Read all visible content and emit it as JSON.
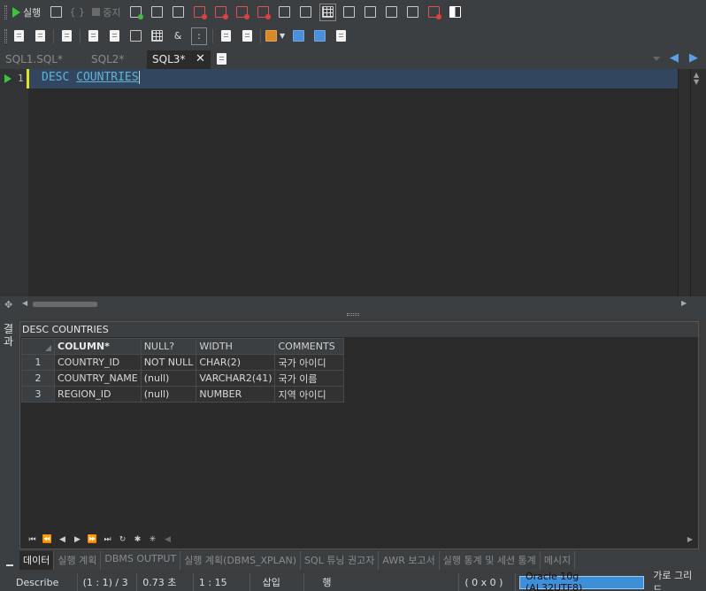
{
  "toolbar1": {
    "run_label": "실행",
    "stop_label": "중지",
    "misc_glyph": "{ }"
  },
  "toolbar2": {
    "ampersand": "&",
    "colon": ":"
  },
  "tabs": [
    {
      "label": "SQL1.SQL*"
    },
    {
      "label": "SQL2*"
    },
    {
      "label": "SQL3*"
    }
  ],
  "editor": {
    "line_number": "1",
    "keyword": "DESC",
    "object": "COUNTRIES"
  },
  "result": {
    "side_tab": "결과",
    "title": "DESC COUNTRIES",
    "columns": [
      "COLUMN*",
      "NULL?",
      "WIDTH",
      "COMMENTS"
    ],
    "rows": [
      {
        "num": "1",
        "column": "COUNTRY_ID",
        "null": "NOT NULL",
        "width": "CHAR(2)",
        "comment": "국가 아이디"
      },
      {
        "num": "2",
        "column": "COUNTRY_NAME",
        "null": "(null)",
        "width": "VARCHAR2(41)",
        "comment": "국가 이름"
      },
      {
        "num": "3",
        "column": "REGION_ID",
        "null": "(null)",
        "width": "NUMBER",
        "comment": "지역 아이디"
      }
    ]
  },
  "result_tabs": [
    "데이터",
    "실행 계획",
    "DBMS OUTPUT",
    "실행 계획(DBMS_XPLAN)",
    "SQL 튜닝 권고자",
    "AWR 보고서",
    "실행 통계 및 세션 통계",
    "메시지"
  ],
  "status": {
    "mode": "Describe",
    "position": "(1 : 1) / 3",
    "elapsed": "0.73 초",
    "cursor": "1 : 15",
    "insert": "삽입",
    "row": "행",
    "selection": "( 0 x 0 )",
    "connection": "Oracle 10g (AL32UTF8)",
    "layout": "가로 그리드"
  },
  "colors": {
    "editor_bg": "#2b2b2b",
    "current_line": "#32475f",
    "keyword": "#5fb3d8",
    "accent": "#3d8fd8"
  }
}
